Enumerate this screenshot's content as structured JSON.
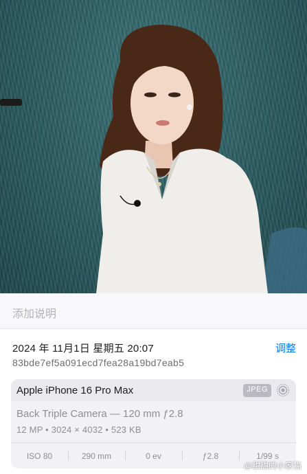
{
  "caption": {
    "placeholder": "添加说明"
  },
  "info": {
    "datetime": "2024 年 11月1日  星期五  20:07",
    "adjust_label": "调整",
    "hash": "83bde7ef5a091ecd7fea28a19bd7eab5"
  },
  "exif": {
    "device": "Apple iPhone 16 Pro Max",
    "format_badge": "JPEG",
    "lens": "Back Triple Camera — 120 mm ƒ2.8",
    "specs": "12 MP  •  3024 × 4032  •  523 KB",
    "values": [
      "ISO 80",
      "290 mm",
      "0 ev",
      "ƒ2.8",
      "1/99 s"
    ]
  },
  "watermark": "@甜甜的小家猫",
  "colors": {
    "accent": "#0a7cf0",
    "background": "#f2f2f7",
    "photo_bg": "#2a5b60"
  },
  "icons": {
    "live_photo": "live-photo-icon"
  }
}
